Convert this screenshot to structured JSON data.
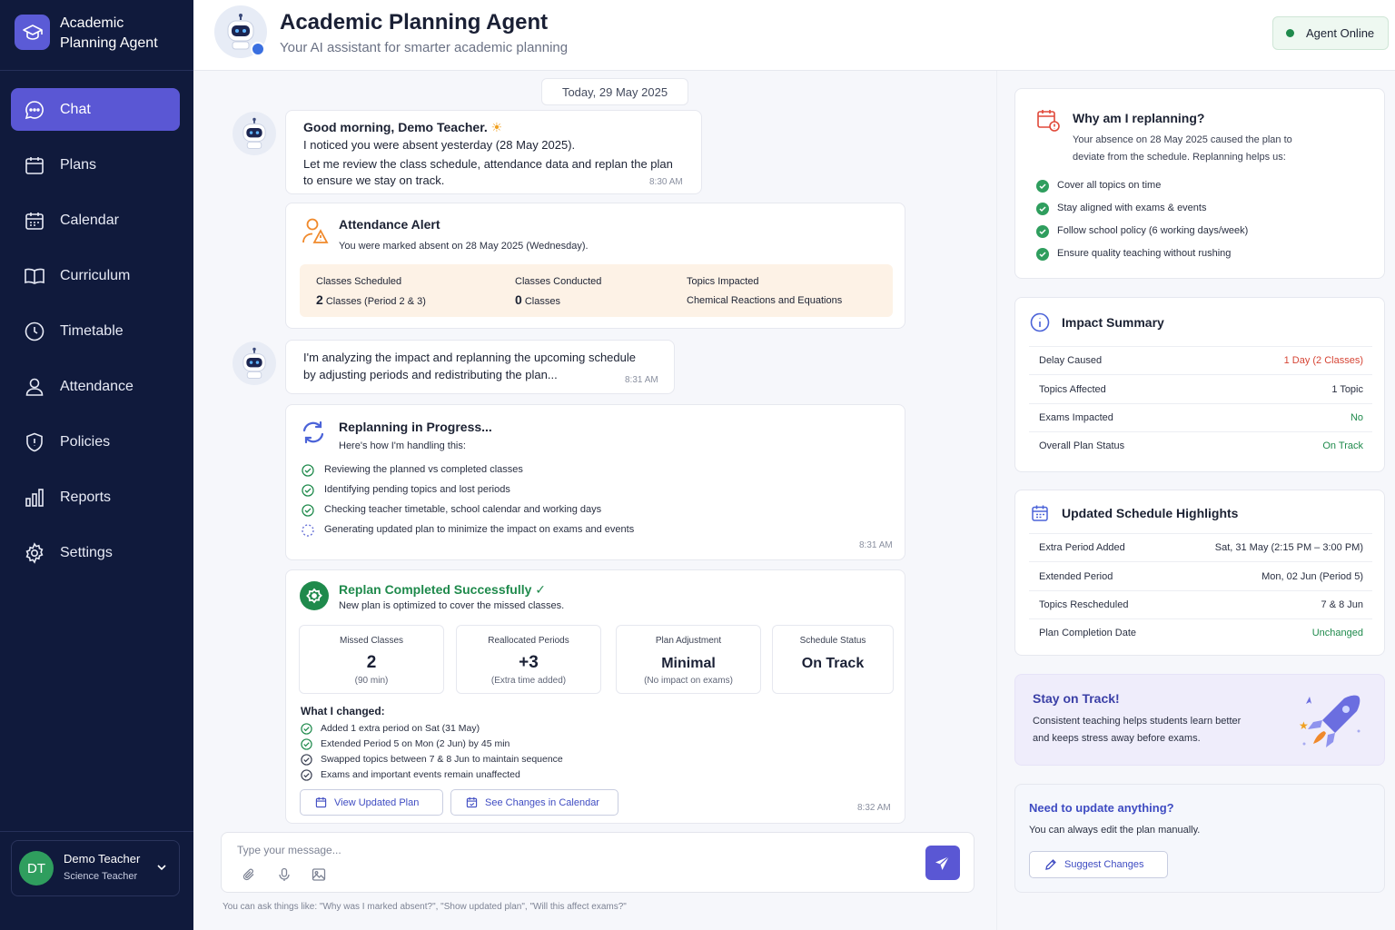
{
  "app": {
    "name_line1": "Academic",
    "name_line2": "Planning Agent"
  },
  "nav": [
    {
      "label": "Chat",
      "icon": "chat-icon"
    },
    {
      "label": "Plans",
      "icon": "calendar-icon"
    },
    {
      "label": "Calendar",
      "icon": "calendar-icon"
    },
    {
      "label": "Curriculum",
      "icon": "book-icon"
    },
    {
      "label": "Timetable",
      "icon": "clock-icon"
    },
    {
      "label": "Attendance",
      "icon": "person-icon"
    },
    {
      "label": "Policies",
      "icon": "shield-icon"
    },
    {
      "label": "Reports",
      "icon": "bar-chart-icon"
    },
    {
      "label": "Settings",
      "icon": "gear-icon"
    }
  ],
  "user": {
    "initials": "DT",
    "name": "Demo Teacher",
    "role": "Science Teacher"
  },
  "header": {
    "title": "Academic Planning Agent",
    "subtitle": "Your AI assistant for smarter academic planning",
    "status": "Agent Online"
  },
  "chat": {
    "date": "Today, 29 May 2025",
    "greeting": {
      "title": "Good morning, Demo Teacher.",
      "line1": "I noticed you were absent yesterday (28 May 2025).",
      "line2": "Let me review the class schedule, attendance data and replan the plan",
      "line3": "to ensure we stay on track.",
      "time": "8:30 AM"
    },
    "alert": {
      "title": "Attendance Alert",
      "text": "You were marked absent on 28 May 2025 (Wednesday).",
      "cols": [
        {
          "label": "Classes Scheduled",
          "value_bold": "2",
          "value": "Classes (Period 2 & 3)"
        },
        {
          "label": "Classes Conducted",
          "value_bold": "0",
          "value": "Classes"
        },
        {
          "label": "Topics Impacted",
          "value_bold": "",
          "value": "Chemical Reactions and Equations"
        }
      ]
    },
    "analyzing": {
      "line1": "I'm analyzing the impact and replanning the upcoming schedule",
      "line2": "by adjusting periods and redistributing the plan...",
      "time": "8:31 AM"
    },
    "progress": {
      "title": "Replanning in Progress...",
      "sub": "Here's how I'm handling this:",
      "steps": [
        "Reviewing the planned vs completed classes",
        "Identifying pending topics and lost periods",
        "Checking teacher timetable, school calendar and working days",
        "Generating updated plan to minimize the impact on exams and events"
      ],
      "time": "8:31 AM"
    },
    "completed": {
      "title": "Replan Completed Successfully",
      "sub": "New plan is optimized to cover the missed classes.",
      "stats": [
        {
          "label": "Missed Classes",
          "value": "2",
          "sub": "(90 min)"
        },
        {
          "label": "Reallocated Periods",
          "value": "+3",
          "sub": "(Extra time added)"
        },
        {
          "label": "Plan Adjustment",
          "value": "Minimal",
          "sub": "(No impact on exams)"
        },
        {
          "label": "Schedule Status",
          "value": "On Track",
          "sub": ""
        }
      ],
      "changes_title": "What I changed:",
      "changes": [
        "Added 1 extra period on Sat (31 May)",
        "Extended Period 5 on Mon (2 Jun) by 45 min",
        "Swapped topics between 7 & 8 Jun to maintain sequence",
        "Exams and important events remain unaffected"
      ],
      "btn_plan": "View Updated Plan",
      "btn_calendar": "See Changes in Calendar",
      "time": "8:32 AM"
    }
  },
  "composer": {
    "placeholder": "Type your message...",
    "hint": "You can ask things like: \"Why was I marked absent?\", \"Show updated plan\", \"Will this affect exams?\""
  },
  "why": {
    "title": "Why am I replanning?",
    "line1": "Your absence on 28 May 2025 caused the plan to",
    "line2": "deviate from the schedule. Replanning helps us:",
    "items": [
      "Cover all topics on time",
      "Stay aligned with exams & events",
      "Follow school policy (6 working days/week)",
      "Ensure quality teaching without rushing"
    ]
  },
  "impact": {
    "title": "Impact Summary",
    "rows": [
      {
        "k": "Delay Caused",
        "v": "1 Day (2 Classes)"
      },
      {
        "k": "Topics Affected",
        "v": "1 Topic"
      },
      {
        "k": "Exams Impacted",
        "v": "No"
      },
      {
        "k": "Overall Plan Status",
        "v": "On Track"
      }
    ]
  },
  "highlights": {
    "title": "Updated Schedule Highlights",
    "rows": [
      {
        "k": "Extra Period Added",
        "v": "Sat, 31 May (2:15 PM – 3:00 PM)"
      },
      {
        "k": "Extended Period",
        "v": "Mon, 02 Jun (Period 5)"
      },
      {
        "k": "Topics Rescheduled",
        "v": "7 & 8 Jun"
      },
      {
        "k": "Plan Completion Date",
        "v": "Unchanged"
      }
    ]
  },
  "stay": {
    "title": "Stay on Track!",
    "line1": "Consistent teaching helps students learn better",
    "line2": "and keeps stress away before exams."
  },
  "update": {
    "title": "Need to update anything?",
    "text": "You can always edit the plan manually.",
    "btn": "Suggest Changes"
  },
  "colors": {
    "accent": "#5a57d4",
    "sidebar": "#101a3c",
    "success": "#1f8a4c",
    "danger": "#d64535",
    "warning": "#f0892b"
  }
}
